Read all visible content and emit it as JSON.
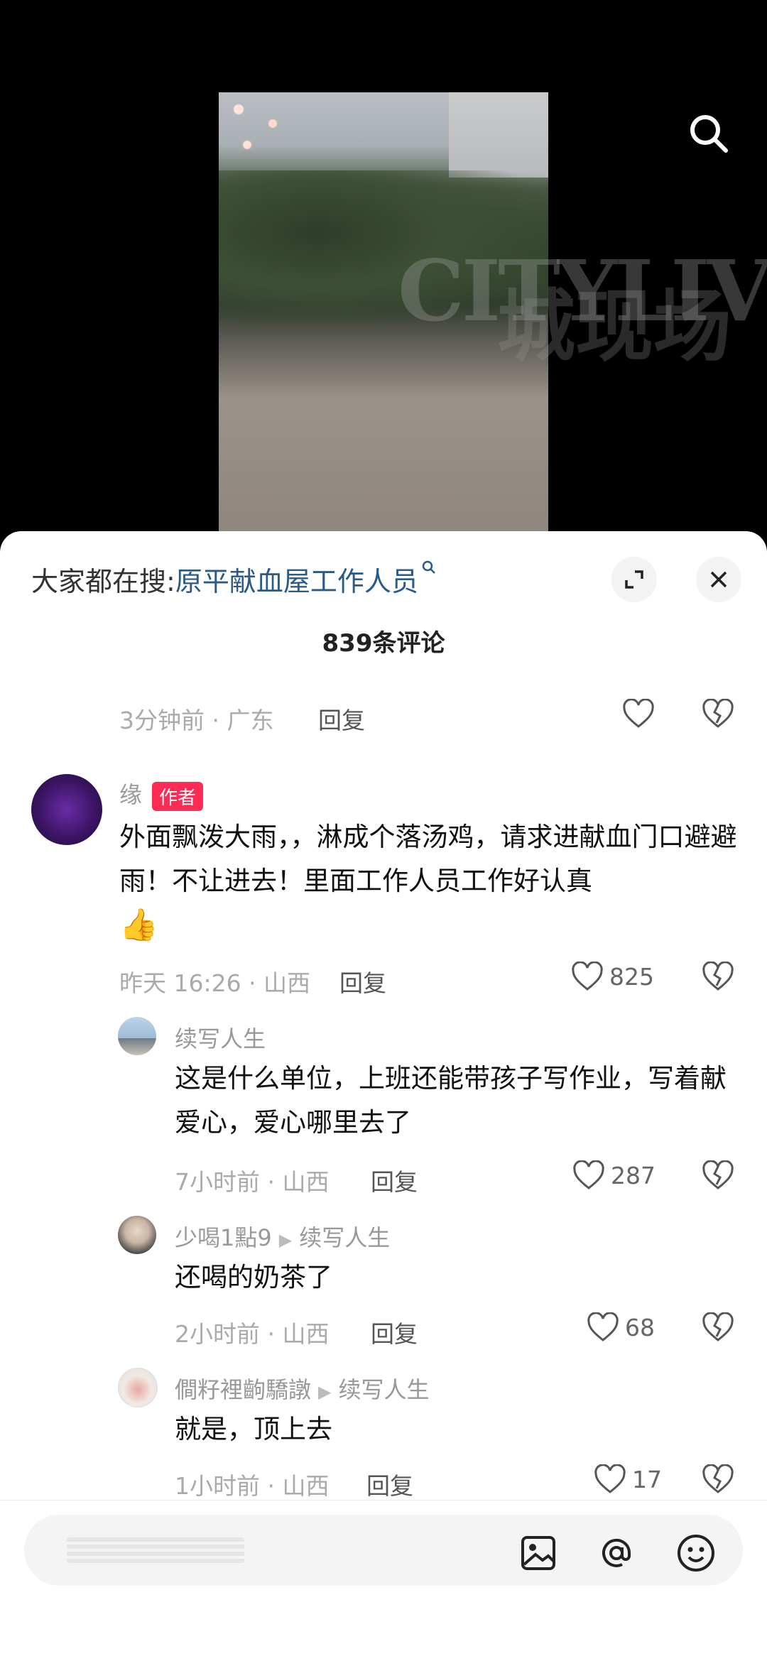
{
  "video": {
    "watermark": "CITYLIVE",
    "watermark_cn": "城现场"
  },
  "sheet": {
    "hot_search_prefix": "大家都在搜:",
    "hot_search_keyword": "原平献血屋工作人员",
    "comment_count": "839条评论"
  },
  "comments": [
    {
      "meta": "3分钟前 · 广东",
      "reply_label": "回复"
    },
    {
      "author": "缘",
      "author_tag": "作者",
      "text": "外面飘泼大雨，，淋成个落汤鸡，请求进献血门口避避雨！不让进去！里面工作人员工作好认真",
      "emoji": "👍",
      "meta": "昨天 16:26 · 山西",
      "reply_label": "回复",
      "likes": "825",
      "replies": [
        {
          "author": "续写人生",
          "text": "这是什么单位，上班还能带孩子写作业，写着献爱心，爱心哪里去了",
          "meta": "7小时前 · 山西",
          "reply_label": "回复",
          "likes": "287"
        },
        {
          "author": "少喝1點9",
          "reply_to": "续写人生",
          "text": "还喝的奶茶了",
          "meta": "2小时前 · 山西",
          "reply_label": "回复",
          "likes": "68"
        },
        {
          "author": "僴籽裡齣驕譈",
          "reply_to": "续写人生",
          "text": "就是，顶上去",
          "meta": "1小时前 · 山西",
          "reply_label": "回复",
          "likes": "17"
        }
      ]
    }
  ],
  "colors": {
    "author_tag": "#fe2c55",
    "keyword": "#2c5a86"
  }
}
